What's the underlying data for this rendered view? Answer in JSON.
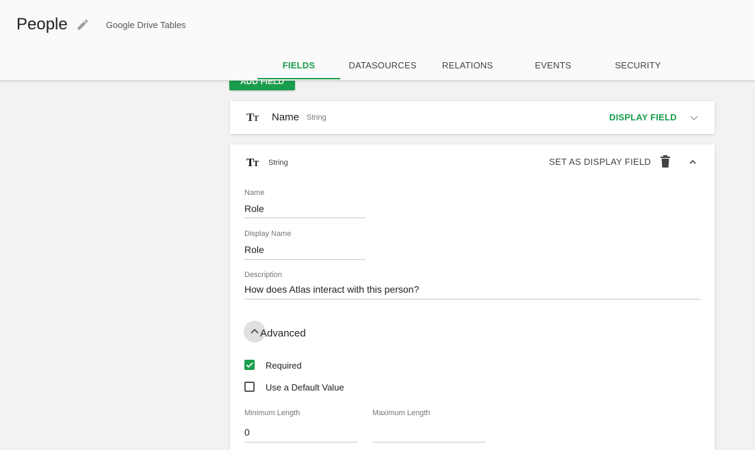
{
  "header": {
    "title": "People",
    "subtitle": "Google Drive Tables"
  },
  "tabs": [
    {
      "label": "FIELDS",
      "active": true
    },
    {
      "label": "DATASOURCES",
      "active": false
    },
    {
      "label": "RELATIONS",
      "active": false
    },
    {
      "label": "EVENTS",
      "active": false
    },
    {
      "label": "SECURITY",
      "active": false
    }
  ],
  "add_button": {
    "label": "ADD FIELD"
  },
  "fields": [
    {
      "icon": "text-type-icon",
      "name": "Name",
      "type": "String",
      "display_label": "DISPLAY FIELD",
      "expanded": false
    },
    {
      "icon": "text-type-icon",
      "type": "String",
      "set_display_label": "SET AS DISPLAY FIELD",
      "expanded": true,
      "form": {
        "name_label": "Name",
        "name_value": "Role",
        "display_name_label": "Display Name",
        "display_name_value": "Role",
        "description_label": "Description",
        "description_value": "How does Atlas interact with this person?",
        "advanced_label": "Advanced",
        "required_label": "Required",
        "required_checked": true,
        "default_label": "Use a Default Value",
        "default_checked": false,
        "min_length_label": "Minimum Length",
        "min_length_value": "0",
        "max_length_label": "Maximum Length",
        "max_length_value": ""
      }
    }
  ],
  "colors": {
    "accent": "#1a9e4d",
    "background": "#f2f2f2",
    "card": "#ffffff"
  }
}
